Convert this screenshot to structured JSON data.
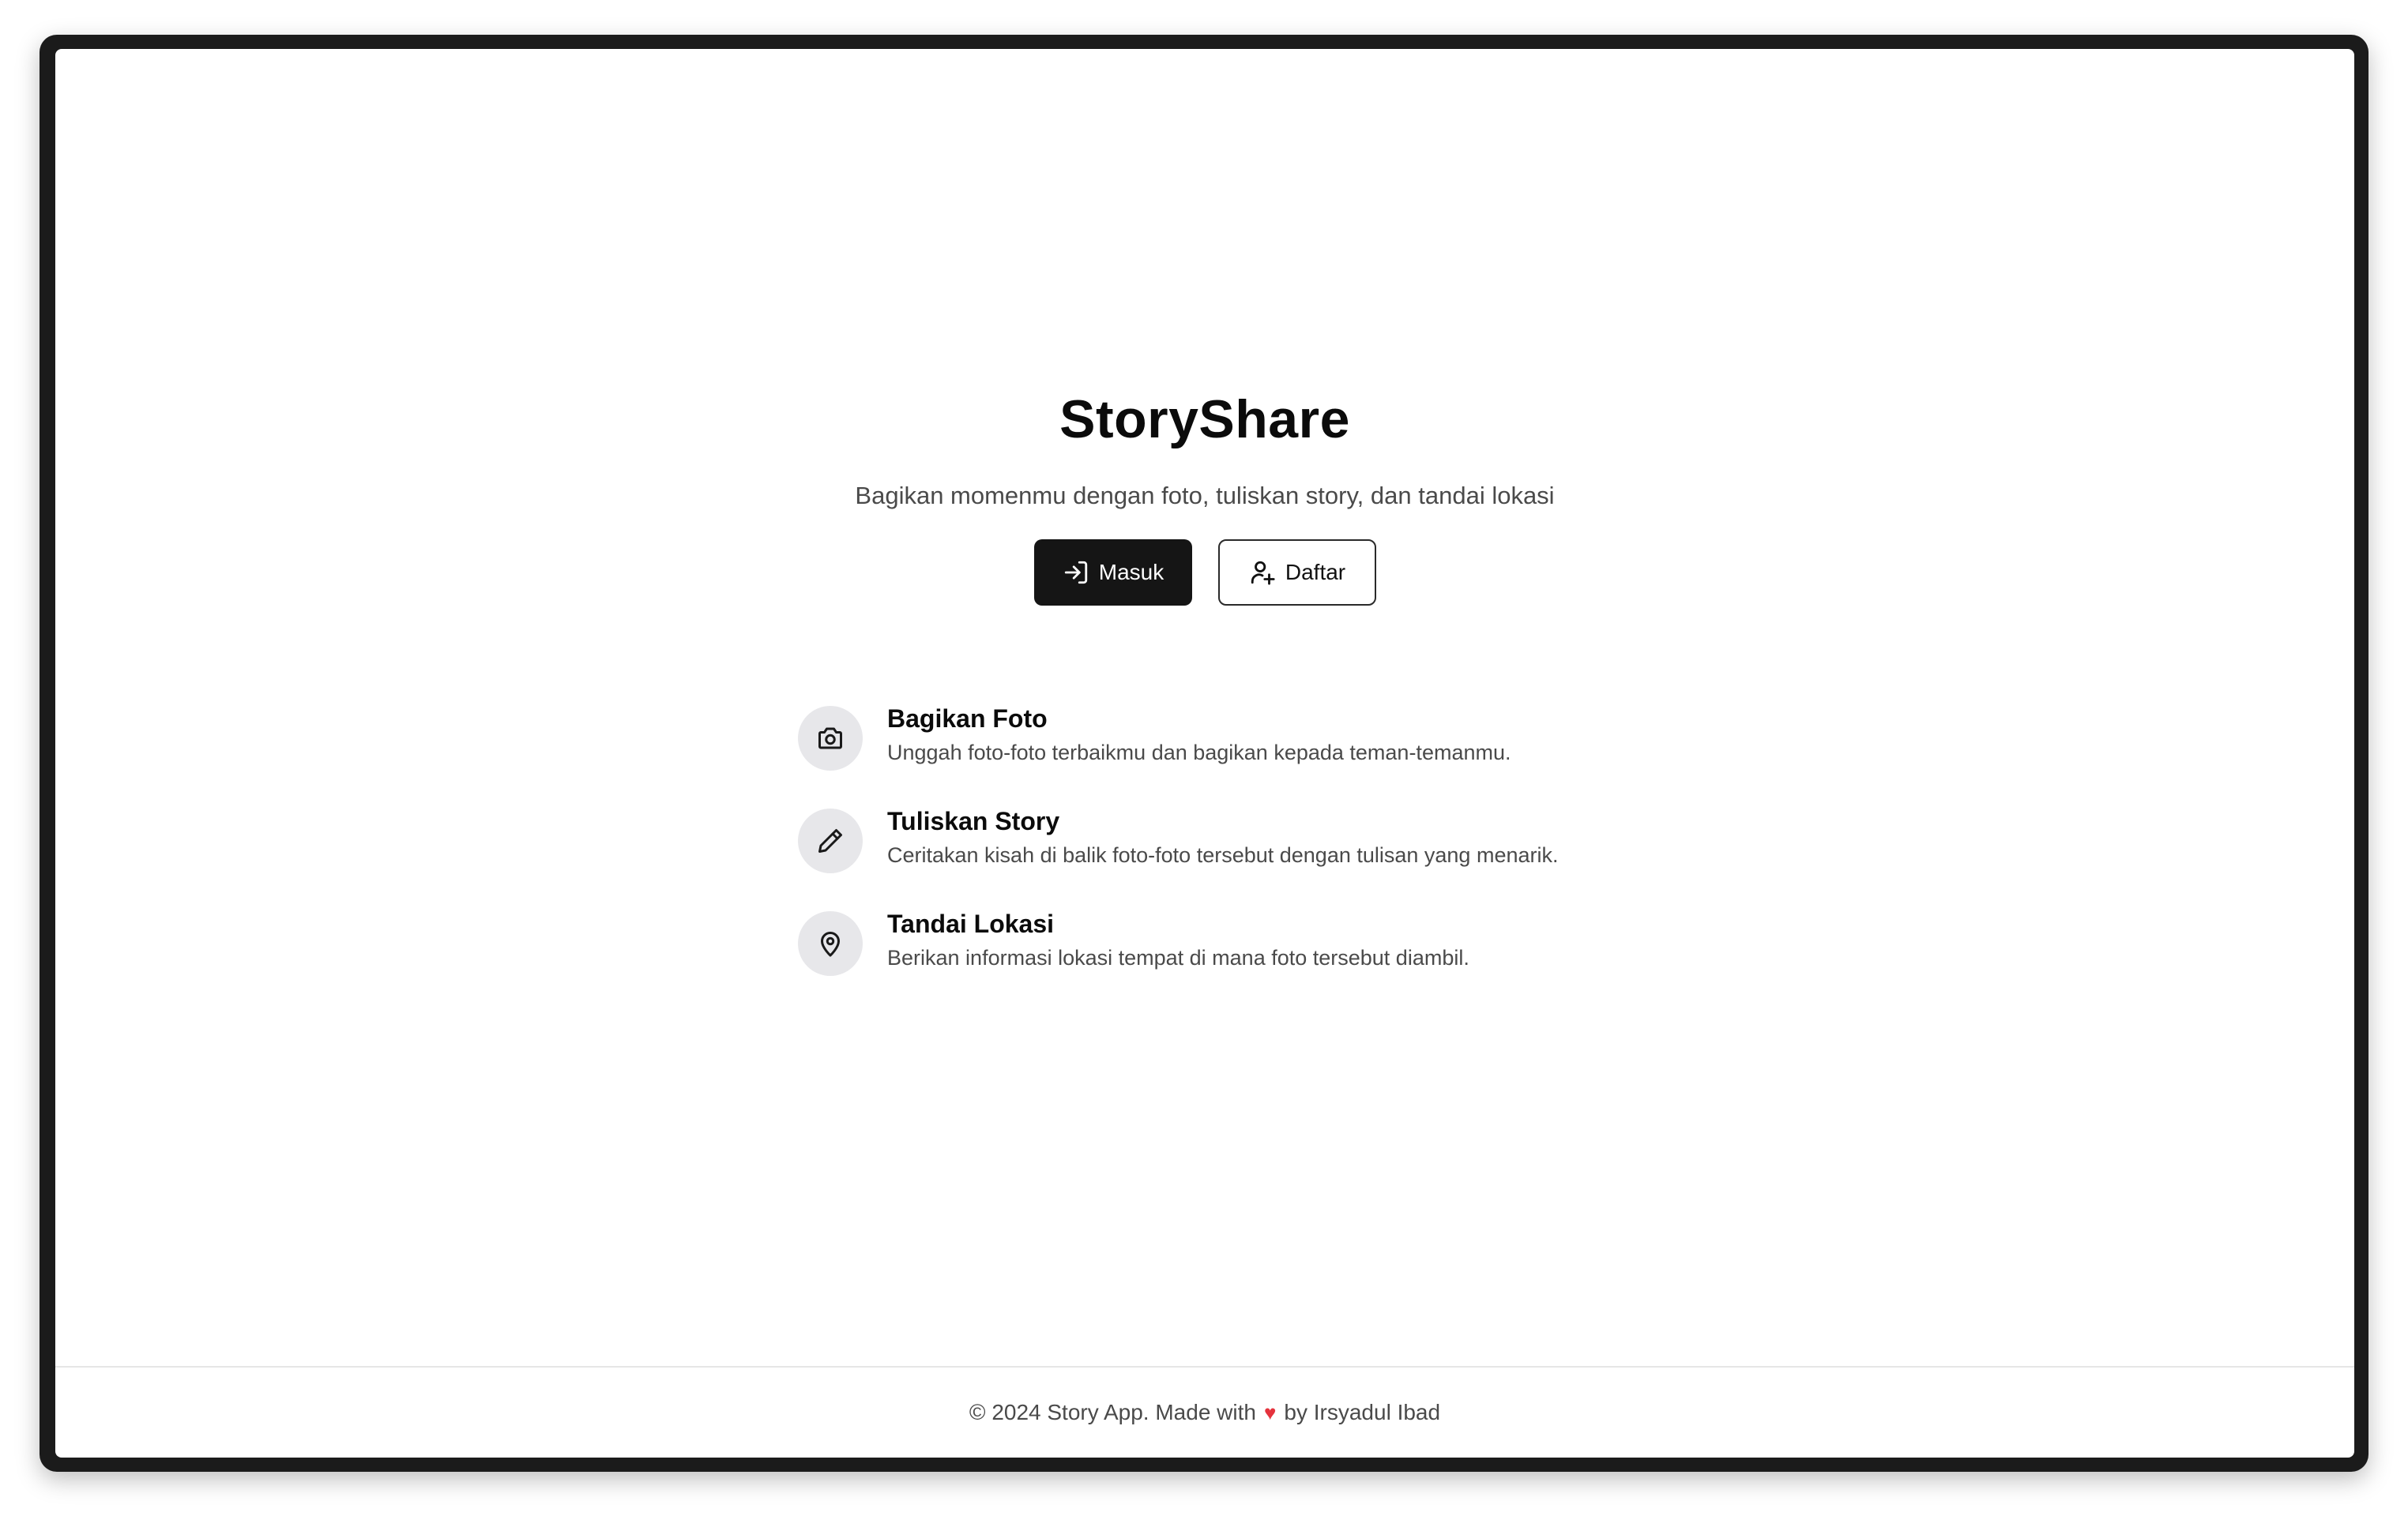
{
  "app": {
    "title": "StoryShare",
    "subtitle": "Bagikan momenmu dengan foto, tuliskan story, dan tandai lokasi"
  },
  "actions": {
    "login_label": "Masuk",
    "register_label": "Daftar"
  },
  "features": [
    {
      "icon": "camera-icon",
      "title": "Bagikan Foto",
      "description": "Unggah foto-foto terbaikmu dan bagikan kepada teman-temanmu."
    },
    {
      "icon": "pencil-icon",
      "title": "Tuliskan Story",
      "description": "Ceritakan kisah di balik foto-foto tersebut dengan tulisan yang menarik."
    },
    {
      "icon": "map-pin-icon",
      "title": "Tandai Lokasi",
      "description": "Berikan informasi lokasi tempat di mana foto tersebut diambil."
    }
  ],
  "footer": {
    "prefix": "© 2024 Story App. Made with",
    "suffix": "by Irsyadul Ibad"
  },
  "colors": {
    "primary_button": "#151515",
    "icon_circle": "#e7e7ea",
    "heart": "#e5333d"
  }
}
